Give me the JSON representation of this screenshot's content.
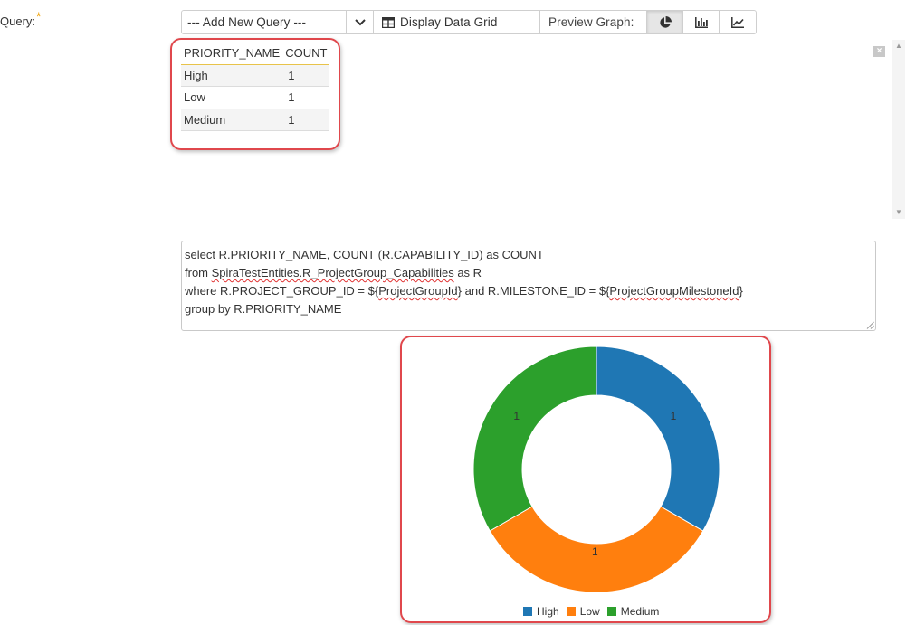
{
  "form": {
    "query_label": "Query:",
    "required_marker": "*"
  },
  "toolbar": {
    "add_query_text": "--- Add New Query ---",
    "display_grid_label": "Display Data Grid",
    "preview_graph_label": "Preview Graph:",
    "chart_buttons": [
      "donut-chart",
      "bar-chart",
      "line-chart"
    ],
    "active_chart": "donut-chart"
  },
  "grid": {
    "columns": [
      "PRIORITY_NAME",
      "COUNT"
    ],
    "rows": [
      [
        "High",
        "1"
      ],
      [
        "Low",
        "1"
      ],
      [
        "Medium",
        "1"
      ]
    ]
  },
  "sql": {
    "line1": "select R.PRIORITY_NAME, COUNT (R.CAPABILITY_ID) as COUNT",
    "line2_pre": "from ",
    "line2_squiggle": "SpiraTestEntities.R_ProjectGroup_Capabilities",
    "line2_post": " as R",
    "line3_a": "where R.PROJECT_GROUP_ID = ${",
    "line3_sq1": "ProjectGroupId",
    "line3_b": "} and R.MILESTONE_ID = ${",
    "line3_sq2": "ProjectGroupMilestoneId",
    "line3_c": "}",
    "line4": "group by R.PRIORITY_NAME"
  },
  "chart_data": {
    "type": "pie",
    "donut": true,
    "categories": [
      "High",
      "Low",
      "Medium"
    ],
    "values": [
      1,
      1,
      1
    ],
    "colors": [
      "#1f77b4",
      "#ff7f0e",
      "#2ca02c"
    ],
    "legend": "bottom"
  },
  "colors": {
    "highlight": "#e0474c",
    "required": "#f0a30a"
  }
}
